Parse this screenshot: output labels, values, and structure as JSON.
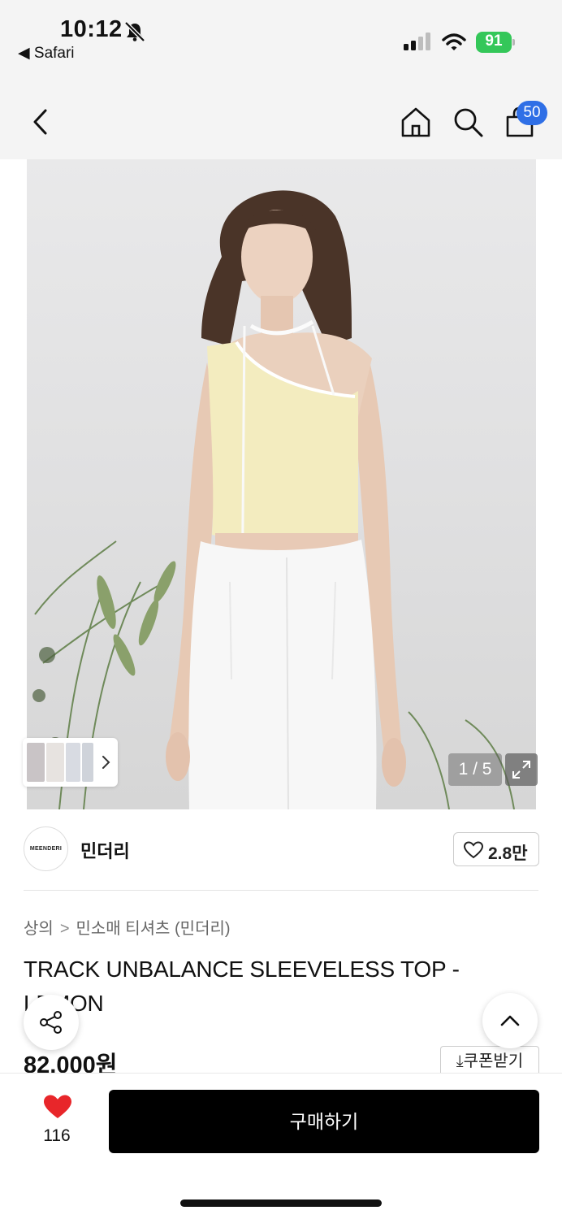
{
  "status_bar": {
    "time": "10:12",
    "back_app": "◀ Safari",
    "battery": "91",
    "battery_color": "#34c759"
  },
  "nav": {
    "cart_count": "50",
    "badge_color": "#2f6fe6"
  },
  "gallery": {
    "counter": "1 / 5"
  },
  "brand": {
    "logo_text": "MEENDERI",
    "name": "민더리",
    "likes": "2.8만"
  },
  "product": {
    "breadcrumb": [
      "상의",
      "민소매 티셔츠 (민더리)"
    ],
    "title": "TRACK UNBALANCE SLEEVELESS TOP - LEMON",
    "price": "82,000원",
    "coupon_label": "쿠폰받기"
  },
  "bottom": {
    "wish_count": "116",
    "buy_label": "구매하기",
    "heart_color": "#e8262a"
  }
}
